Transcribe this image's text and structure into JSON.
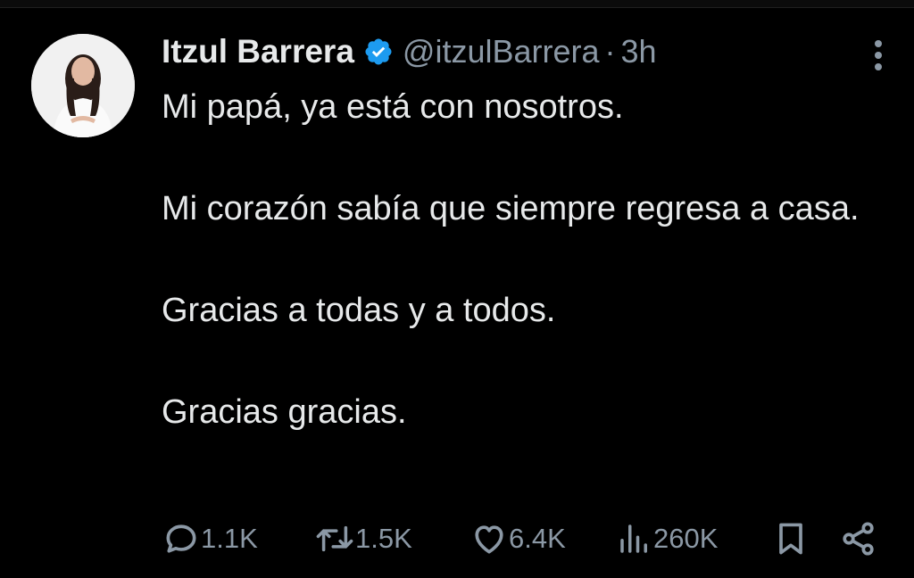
{
  "tweet": {
    "author_name": "Itzul Barrera",
    "handle": "@itzulBarrera",
    "separator": "·",
    "time": "3h",
    "lines": [
      "Mi papá, ya está con nosotros.",
      "Mi corazón sabía que siempre regresa a casa.",
      "Gracias a todas y a todos.",
      "Gracias gracias."
    ]
  },
  "stats": {
    "replies": "1.1K",
    "reposts": "1.5K",
    "likes": "6.4K",
    "views": "260K"
  },
  "colors": {
    "background": "#000000",
    "text": "#e7e9ea",
    "muted": "#8b98a5",
    "verified": "#1d9bf0"
  },
  "icons": [
    "verified-badge-icon",
    "more-options-icon",
    "reply-icon",
    "repost-icon",
    "like-icon",
    "views-icon",
    "bookmark-icon",
    "share-icon"
  ]
}
